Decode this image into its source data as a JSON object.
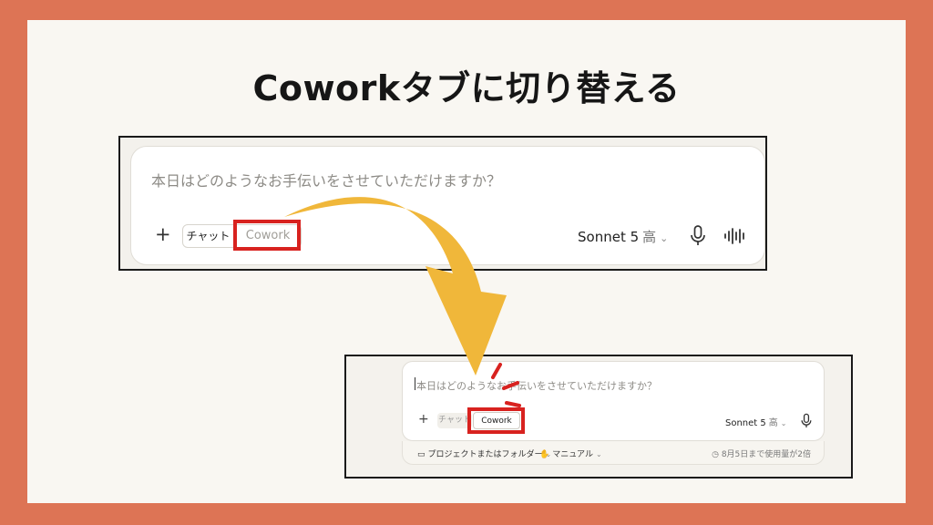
{
  "title": "Coworkタブに切り替える",
  "before": {
    "placeholder": "本日はどのようなお手伝いをさせていただけますか？",
    "plus": "+",
    "tabs": [
      "チャット",
      "Cowork"
    ],
    "model": "Sonnet 5",
    "effort": "高",
    "chevron": "⌄"
  },
  "after": {
    "placeholder": "本日はどのようなお手伝いをさせていただけますか？",
    "plus": "+",
    "tabs": [
      "チャット",
      "Cowork"
    ],
    "model": "Sonnet 5",
    "effort": "高",
    "chevron": "⌄",
    "project_label": "プロジェクトまたはフォルダー",
    "mode_label": "マニュアル",
    "usage_note": "8月5日まで使用量が2倍"
  },
  "colors": {
    "background": "#dd7455",
    "card": "#f9f7f2",
    "highlight": "#d8221f",
    "arrow": "#f0b73a"
  },
  "icons": [
    "plus-icon",
    "mic-icon",
    "waveform-icon",
    "folder-icon",
    "hand-icon",
    "clock-icon",
    "chevron-down-icon",
    "curved-arrow-icon",
    "burst-icon"
  ]
}
